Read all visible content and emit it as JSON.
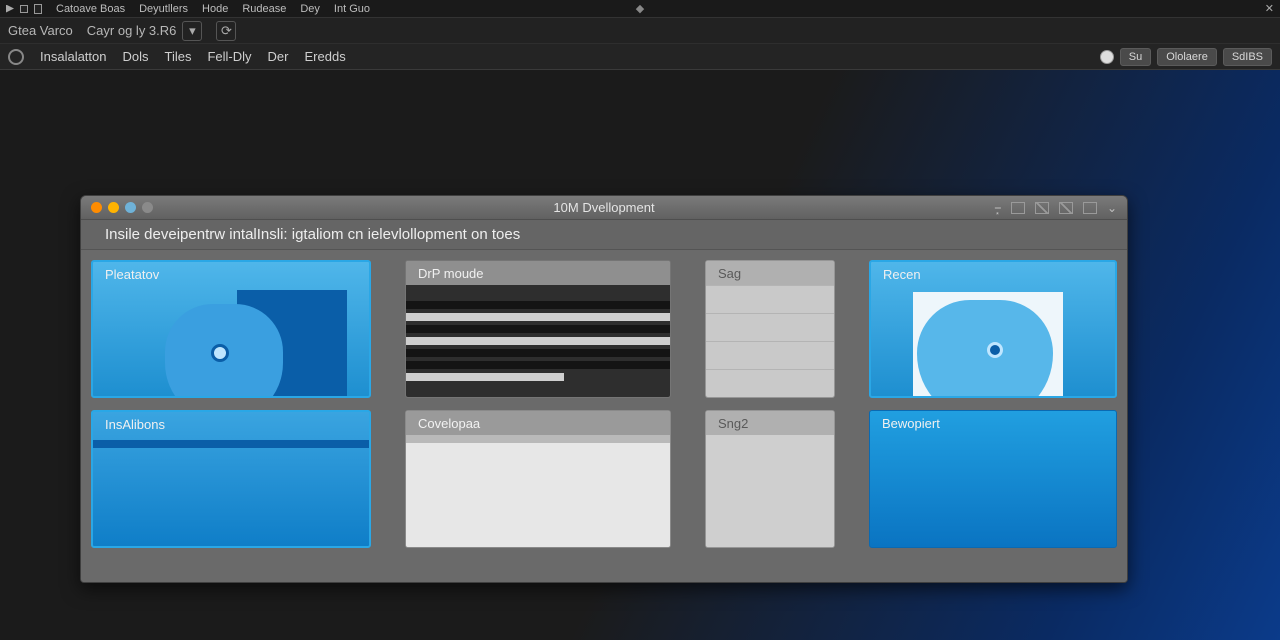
{
  "os_menu": {
    "items": [
      "Catoave Boas",
      "Deyutllers",
      "Hode",
      "Rudease",
      "Dey",
      "Int Guo"
    ]
  },
  "app_row1": {
    "title": "Gtea Varco",
    "project": "Cayr og ly 3.R6"
  },
  "app_row2": {
    "tabs": [
      "Insalalatton",
      "Dols",
      "Tiles",
      "Fell-Dly",
      "Der",
      "Eredds"
    ],
    "right": {
      "b1": "Su",
      "b2": "Ololaere",
      "b3": "SdIBS"
    }
  },
  "inner": {
    "title": "10M  Dvellopment",
    "subtitle": "Insile deveipentrw intalInsli: igtaliom cn ielevlollopment on toes",
    "cards": {
      "a1": "Pleatatov",
      "a2": "InsAlibons",
      "b1": "DrP moude",
      "b2": "Covelopaa",
      "c1": "Sag",
      "c2": "Sng2",
      "d1": "Recen",
      "d2": "Bewopiert"
    }
  }
}
